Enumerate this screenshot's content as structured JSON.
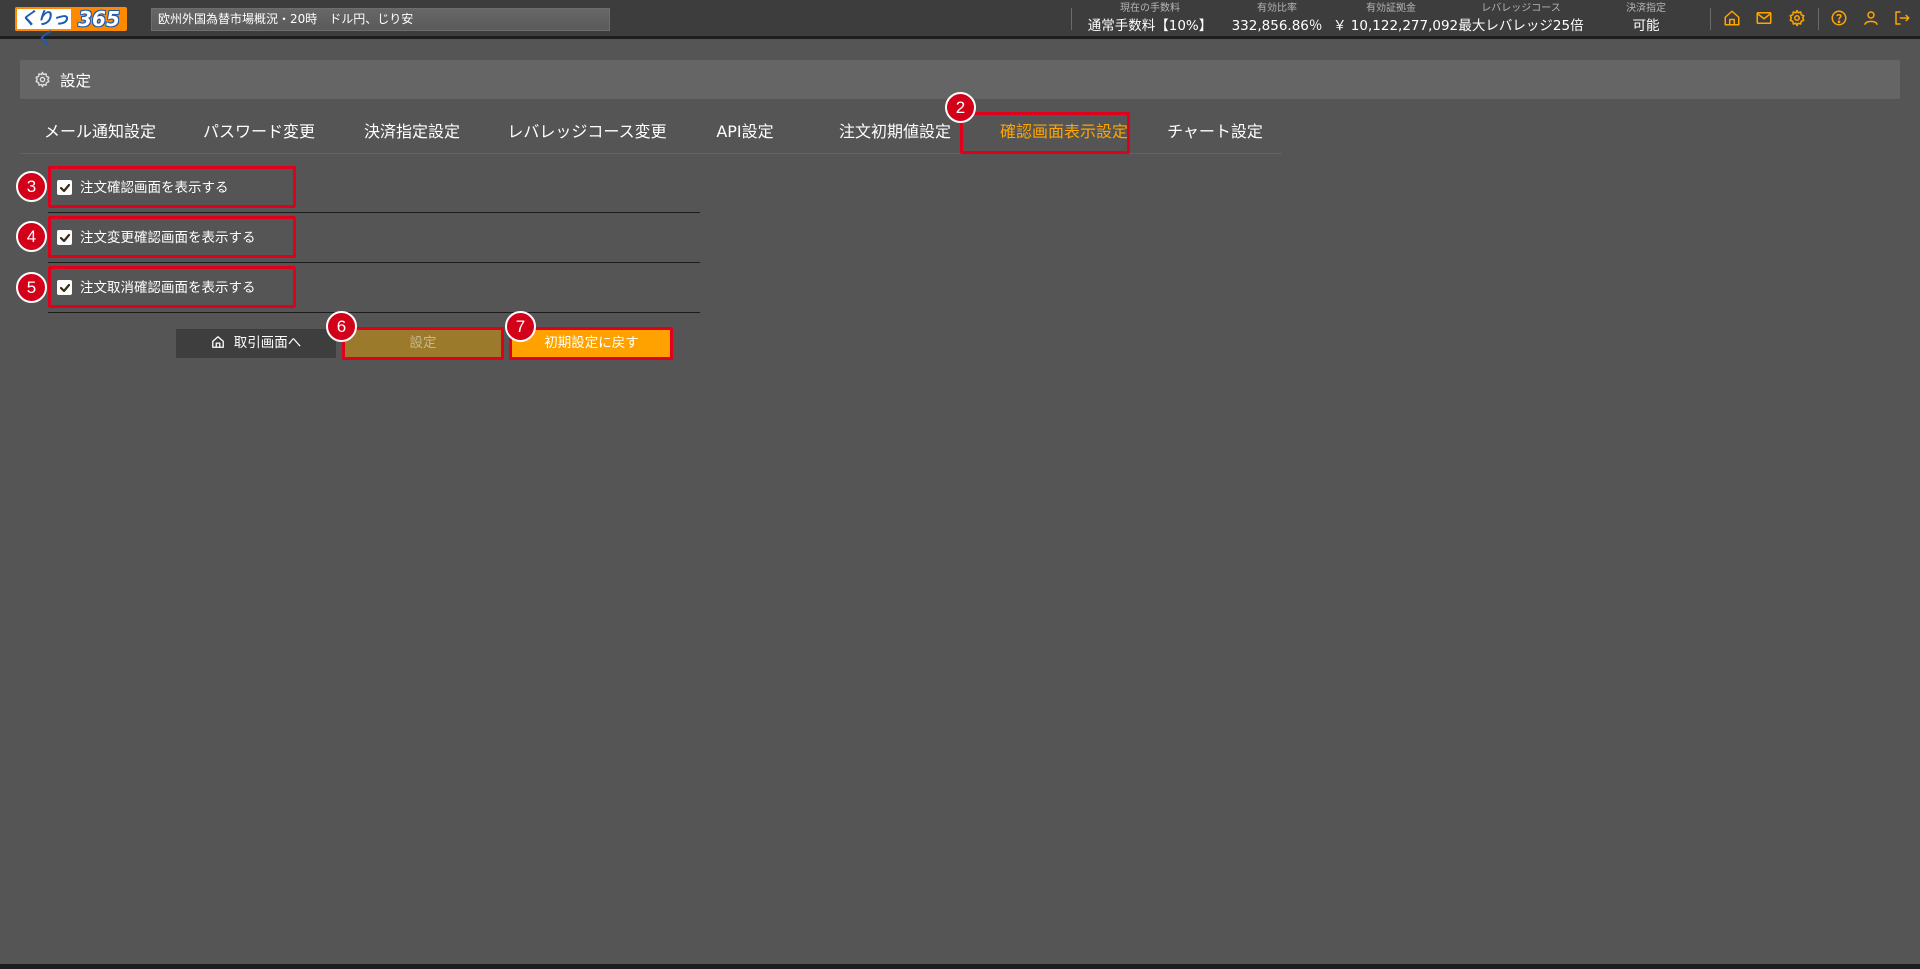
{
  "header": {
    "logo_left": "くりっく",
    "logo_right": "365",
    "news": "欧州外国為替市場概況・20時　ドル円、じり安",
    "stats": [
      {
        "label": "現在の手数料",
        "value": "通常手数料【10%】"
      },
      {
        "label": "有効比率",
        "value": "332,856.86％"
      },
      {
        "label": "有効証拠金",
        "value": "￥ 10,122,277,092"
      },
      {
        "label": "レバレッジコース",
        "value": "最大レバレッジ25倍"
      },
      {
        "label": "決済指定",
        "value": "可能"
      }
    ],
    "icon_color": "#ffa500"
  },
  "page": {
    "title": "設定"
  },
  "tabs": [
    {
      "label": "メール通知設定"
    },
    {
      "label": "パスワード変更"
    },
    {
      "label": "決済指定設定"
    },
    {
      "label": "レバレッジコース変更"
    },
    {
      "label": "API設定"
    },
    {
      "label": "注文初期値設定"
    },
    {
      "label": "確認画面表示設定",
      "active": true
    },
    {
      "label": "チャート設定"
    }
  ],
  "checkboxes": [
    {
      "label": "注文確認画面を表示する",
      "checked": true
    },
    {
      "label": "注文変更確認画面を表示する",
      "checked": true
    },
    {
      "label": "注文取消確認画面を表示する",
      "checked": true
    }
  ],
  "buttons": {
    "home": "取引画面へ",
    "save": "設定",
    "reset": "初期設定に戻す"
  },
  "annotations": [
    "2",
    "3",
    "4",
    "5",
    "6",
    "7"
  ],
  "colors": {
    "accent": "#ffa500",
    "highlight": "#e0001b",
    "background": "#555555"
  }
}
